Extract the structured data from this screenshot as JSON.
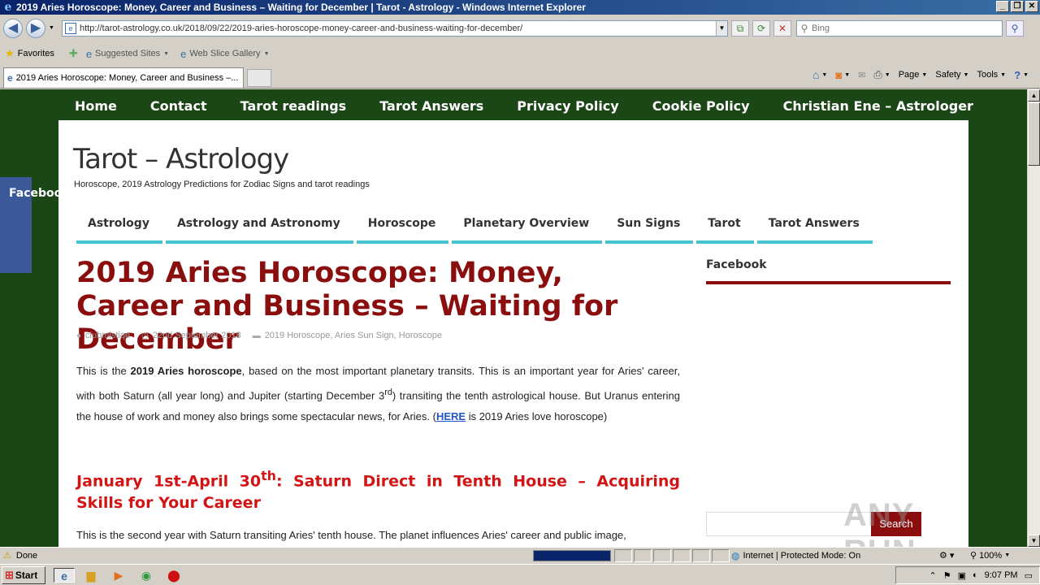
{
  "window": {
    "title": "2019 Aries Horoscope: Money, Career and Business – Waiting for December | Tarot - Astrology - Windows Internet Explorer",
    "buttons": [
      "_",
      "❐",
      "✕"
    ]
  },
  "address_bar": {
    "url": "http://tarot-astrology.co.uk/2018/09/22/2019-aries-horoscope-money-career-and-business-waiting-for-december/",
    "search_placeholder": "Bing"
  },
  "favorites_bar": {
    "favorites_label": "Favorites",
    "suggested_sites": "Suggested Sites",
    "web_slice_gallery": "Web Slice Gallery"
  },
  "tab": {
    "label": "2019 Aries Horoscope: Money, Career and Business –..."
  },
  "command_bar": {
    "page": "Page",
    "safety": "Safety",
    "tools": "Tools"
  },
  "site": {
    "top_nav": [
      "Home",
      "Contact",
      "Tarot readings",
      "Tarot Answers",
      "Privacy Policy",
      "Cookie Policy",
      "Christian Ene – Astrologer"
    ],
    "facebook_tab": "Facebook",
    "title": "Tarot – Astrology",
    "tagline": "Horoscope, 2019 Astrology Predictions for Zodiac Signs and tarot readings",
    "categories": [
      "Astrology",
      "Astrology and Astronomy",
      "Horoscope",
      "Planetary Overview",
      "Sun Signs",
      "Tarot",
      "Tarot Answers"
    ]
  },
  "post": {
    "title": "2019 Aries Horoscope: Money, Career and Business – Waiting for December",
    "author": "clubmistiqe",
    "date": "22nd September 2018",
    "categories": "2019 Horoscope, Aries Sun Sign, Horoscope",
    "para1_a": "This is the ",
    "para1_bold": "2019 Aries horoscope",
    "para1_b": ", based on the most important planetary transits. This is an important year for Aries' career, with both Saturn (all year long) and Jupiter (starting December 3",
    "para1_sup": "rd",
    "para1_c": ") transiting the tenth astrological house. But Uranus entering the house of work and money also brings some spectacular news, for Aries. (",
    "para1_link": "HERE",
    "para1_d": " is 2019 Aries love horoscope)",
    "h3_a": "January 1st-April 30",
    "h3_sup": "th",
    "h3_b": ": Saturn Direct in Tenth House – Acquiring Skills for Your Career",
    "para2": "This is the second year with Saturn transiting Aries' tenth house. The planet influences Aries' career and public image,"
  },
  "sidebar": {
    "widget_title": "Facebook",
    "search_button": "Search"
  },
  "watermark": "ANY RUN",
  "status_bar": {
    "status": "Done",
    "progress": 1.0,
    "zone": "Internet | Protected Mode: On",
    "zoom": "100%"
  },
  "taskbar": {
    "start": "Start",
    "clock": "9:07 PM"
  },
  "colors": {
    "page_bg": "#1b4716",
    "post_title": "#8b0e0e",
    "heading": "#d21414",
    "category_underline": "#45c3d0",
    "facebook": "#3b5998",
    "link": "#2255cc"
  }
}
